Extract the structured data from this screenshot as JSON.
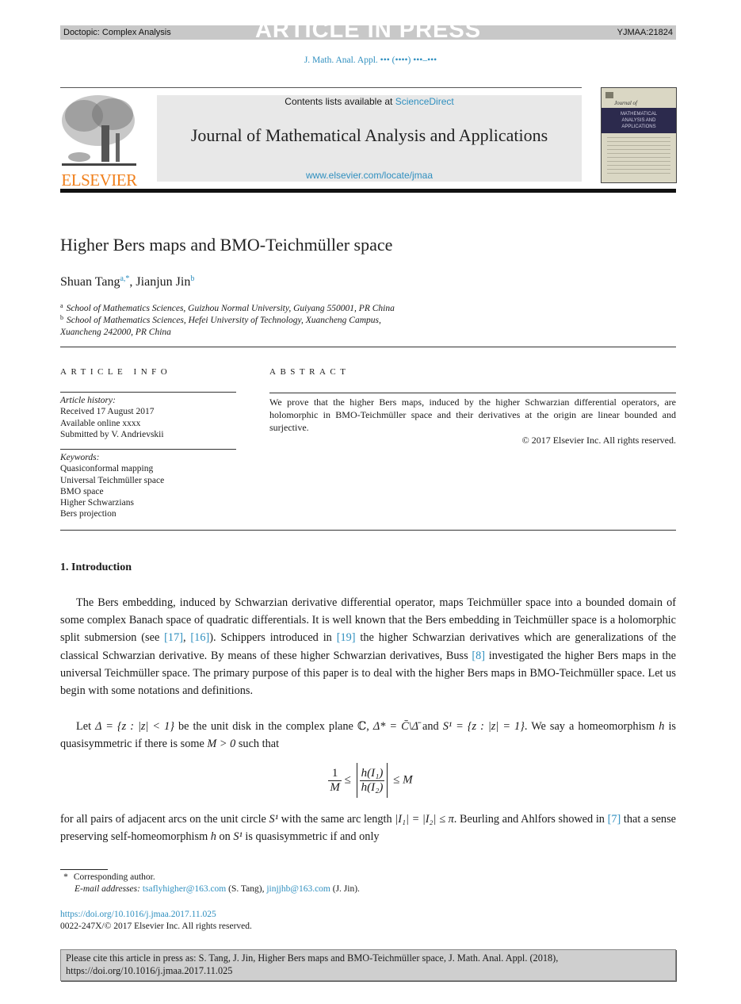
{
  "banner": {
    "doctopic": "Doctopic: Complex Analysis",
    "status": "ARTICLE IN PRESS",
    "article_id": "YJMAA:21824"
  },
  "journal_ref": "J. Math. Anal. Appl. ••• (••••) •••–•••",
  "header": {
    "publisher_logo_text": "ELSEVIER",
    "contents_prefix": "Contents lists available at ",
    "contents_link": "ScienceDirect",
    "journal_title": "Journal of Mathematical Analysis and Applications",
    "journal_url": "www.elsevier.com/locate/jmaa",
    "cover": {
      "script_title": "Journal of",
      "band_lines": [
        "MATHEMATICAL",
        "ANALYSIS AND",
        "APPLICATIONS"
      ]
    }
  },
  "article": {
    "title": "Higher Bers maps and BMO-Teichmüller space",
    "authors": [
      {
        "name": "Shuan Tang",
        "marks": "a,*"
      },
      {
        "name": "Jianjun Jin",
        "marks": "b"
      }
    ],
    "affiliations": [
      {
        "mark": "a",
        "text": "School of Mathematics Sciences, Guizhou Normal University, Guiyang 550001, PR China"
      },
      {
        "mark": "b",
        "text": "School of Mathematics Sciences, Hefei University of Technology, Xuancheng Campus,",
        "text2": "Xuancheng 242000, PR China"
      }
    ]
  },
  "article_info": {
    "heading": "ARTICLE INFO",
    "history_label": "Article history:",
    "history": [
      "Received 17 August 2017",
      "Available online xxxx",
      "Submitted by V. Andrievskii"
    ],
    "keywords_label": "Keywords:",
    "keywords": [
      "Quasiconformal mapping",
      "Universal Teichmüller space",
      "BMO space",
      "Higher Schwarzians",
      "Bers projection"
    ]
  },
  "abstract": {
    "heading": "ABSTRACT",
    "text": "We prove that the higher Bers maps, induced by the higher Schwarzian differential operators, are holomorphic in BMO-Teichmüller space and their derivatives at the origin are linear bounded and surjective.",
    "copyright": "© 2017 Elsevier Inc. All rights reserved."
  },
  "body": {
    "section_title": "1. Introduction",
    "p1": {
      "a": "The Bers embedding, induced by Schwarzian derivative differential operator, maps Teichmüller space into a bounded domain of some complex Banach space of quadratic differentials. It is well known that the Bers embedding in Teichmüller space is a holomorphic split submersion (see ",
      "ref1": "[17]",
      "b": ", ",
      "ref2": "[16]",
      "c": "). Schippers introduced in ",
      "ref3": "[19]",
      "d": " the higher Schwarzian derivatives which are generalizations of the classical Schwarzian derivative. By means of these higher Schwarzian derivatives, Buss ",
      "ref4": "[8]",
      "e": " investigated the higher Bers maps in the universal Teichmüller space. The primary purpose of this paper is to deal with the higher Bers maps in BMO-Teichmüller space. Let us begin with some notations and definitions."
    },
    "p2": {
      "a": "Let ",
      "m1": "Δ = {z : |z| < 1}",
      "b": " be the unit disk in the complex plane ℂ, ",
      "m2": "Δ* = C̄\\Δ̄",
      "c": " and ",
      "m3": "S¹ = {z : |z| = 1}",
      "d": ". We say a homeomorphism ",
      "m4": "h",
      "e": " is quasisymmetric if there is some ",
      "m5": "M > 0",
      "f": " such that"
    },
    "equation": {
      "lhs_num": "1",
      "lhs_den": "M",
      "le1": "≤",
      "num": "h(I₁)",
      "den": "h(I₂)",
      "le2": "≤ M"
    },
    "p3": {
      "a": "for all pairs of adjacent arcs on the unit circle ",
      "m1": "S¹",
      "b": " with the same arc length ",
      "m2": "|I₁| = |I₂| ≤ π",
      "c": ". Beurling and Ahlfors showed in ",
      "ref1": "[7]",
      "d": " that a sense preserving self-homeomorphism ",
      "m3": "h",
      "e": " on ",
      "m4": "S¹",
      "f": " is quasisymmetric if and only"
    }
  },
  "footnotes": {
    "star": "*",
    "corresponding": "Corresponding author.",
    "email_label": "E-mail addresses: ",
    "email1": "tsaflyhigher@163.com",
    "email1_owner": " (S. Tang), ",
    "email2": "jinjjhb@163.com",
    "email2_owner": " (J. Jin).",
    "doi": "https://doi.org/10.1016/j.jmaa.2017.11.025",
    "issn": "0022-247X/© 2017 Elsevier Inc. All rights reserved."
  },
  "cite_box": {
    "line1": "Please cite this article in press as: S. Tang, J. Jin, Higher Bers maps and BMO-Teichmüller space, J. Math. Anal. Appl. (2018),",
    "line2": "https://doi.org/10.1016/j.jmaa.2017.11.025"
  }
}
